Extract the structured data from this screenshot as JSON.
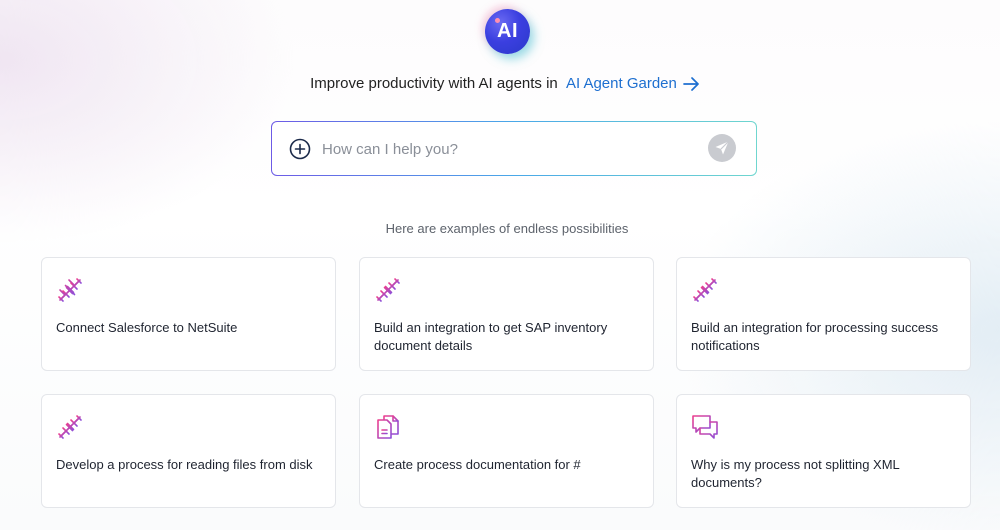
{
  "logo": {
    "text": "AI"
  },
  "promo": {
    "text": "Improve productivity with AI agents in",
    "link_label": "AI Agent Garden"
  },
  "search": {
    "placeholder": "How can I help you?"
  },
  "examples": {
    "heading": "Here are examples of endless possibilities",
    "cards": [
      {
        "icon": "unplug-icon",
        "text": "Connect Salesforce to NetSuite"
      },
      {
        "icon": "unplug-icon",
        "text": "Build an integration to get SAP inventory document details"
      },
      {
        "icon": "unplug-icon",
        "text": "Build an integration for processing success notifications"
      },
      {
        "icon": "unplug-icon",
        "text": "Develop a process for reading files from disk"
      },
      {
        "icon": "documents-icon",
        "text": "Create process documentation for #"
      },
      {
        "icon": "chat-bubbles-icon",
        "text": "Why is my process not splitting XML documents?"
      }
    ]
  },
  "colors": {
    "accent": "#1e6fd0",
    "icon_gradient_start": "#e5409a",
    "icon_gradient_end": "#9a4ad6"
  }
}
